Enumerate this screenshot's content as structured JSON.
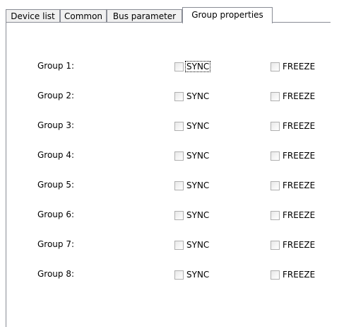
{
  "tabs": [
    {
      "label": "Device list",
      "active": false
    },
    {
      "label": "Common",
      "active": false
    },
    {
      "label": "Bus parameter",
      "active": false
    },
    {
      "label": "Group properties",
      "active": true
    }
  ],
  "groups": [
    {
      "label": "Group 1:",
      "sync_label": "SYNC",
      "sync_checked": false,
      "freeze_label": "FREEZE",
      "freeze_checked": false,
      "sync_focused": true
    },
    {
      "label": "Group 2:",
      "sync_label": "SYNC",
      "sync_checked": false,
      "freeze_label": "FREEZE",
      "freeze_checked": false
    },
    {
      "label": "Group 3:",
      "sync_label": "SYNC",
      "sync_checked": false,
      "freeze_label": "FREEZE",
      "freeze_checked": false
    },
    {
      "label": "Group 4:",
      "sync_label": "SYNC",
      "sync_checked": false,
      "freeze_label": "FREEZE",
      "freeze_checked": false
    },
    {
      "label": "Group 5:",
      "sync_label": "SYNC",
      "sync_checked": false,
      "freeze_label": "FREEZE",
      "freeze_checked": false
    },
    {
      "label": "Group 6:",
      "sync_label": "SYNC",
      "sync_checked": false,
      "freeze_label": "FREEZE",
      "freeze_checked": false
    },
    {
      "label": "Group 7:",
      "sync_label": "SYNC",
      "sync_checked": false,
      "freeze_label": "FREEZE",
      "freeze_checked": false
    },
    {
      "label": "Group 8:",
      "sync_label": "SYNC",
      "sync_checked": false,
      "freeze_label": "FREEZE",
      "freeze_checked": false
    }
  ]
}
